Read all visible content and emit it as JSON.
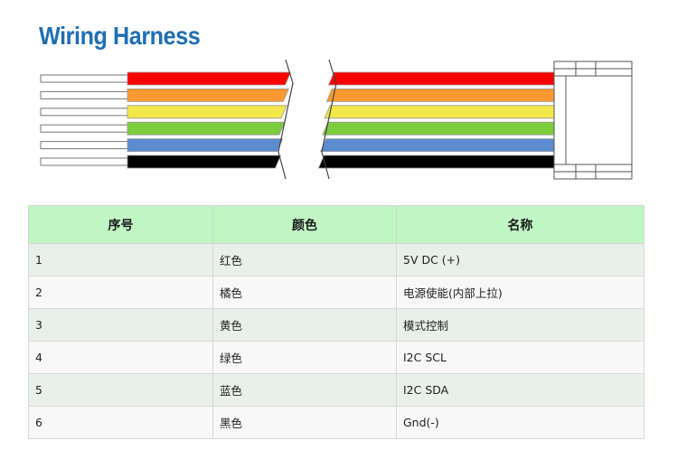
{
  "title": "Wiring Harness",
  "diagram": {
    "wire_colors": [
      "#ff0000",
      "#ff9933",
      "#f2e84a",
      "#7ccc3c",
      "#5b8cd0",
      "#000000"
    ],
    "insulation_color": "#ffffff"
  },
  "table": {
    "headers": [
      "序号",
      "颜色",
      "名称"
    ],
    "header_bg": "#c0f5c4",
    "rows": [
      {
        "no": "1",
        "color": "红色",
        "name": "5V DC (+)"
      },
      {
        "no": "2",
        "color": "橘色",
        "name": "电源使能(内部上拉)"
      },
      {
        "no": "3",
        "color": "黄色",
        "name": "模式控制"
      },
      {
        "no": "4",
        "color": "绿色",
        "name": "I2C SCL"
      },
      {
        "no": "5",
        "color": "蓝色",
        "name": "I2C SDA"
      },
      {
        "no": "6",
        "color": "黑色",
        "name": "Gnd(-)"
      }
    ]
  }
}
